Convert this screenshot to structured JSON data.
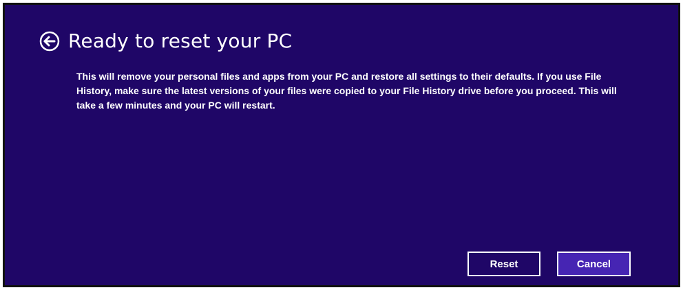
{
  "dialog": {
    "title": "Ready to reset your PC",
    "back_icon": "back-arrow-icon",
    "description": "This will remove your personal files and apps from your PC and restore all settings to their defaults. If you use File History, make sure the latest versions of your files were copied to your File History drive before you proceed. This will take a few minutes and your PC will restart.",
    "buttons": {
      "reset_label": "Reset",
      "cancel_label": "Cancel"
    }
  },
  "colors": {
    "background": "#1f0667",
    "accent_button": "#4625b3",
    "text": "#ffffff"
  }
}
